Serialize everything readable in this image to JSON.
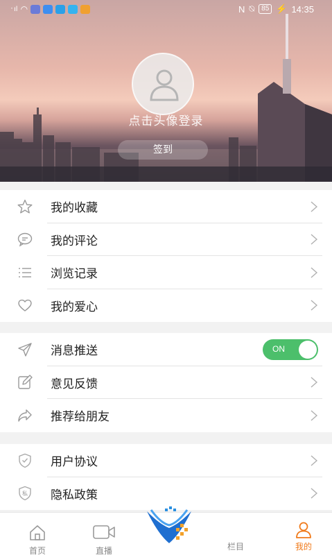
{
  "status_bar": {
    "time": "14:35",
    "battery": "85"
  },
  "profile": {
    "login_prompt": "点击头像登录",
    "checkin_label": "签到"
  },
  "section1": [
    {
      "label": "我的收藏",
      "icon": "star-icon"
    },
    {
      "label": "我的评论",
      "icon": "comment-icon"
    },
    {
      "label": "浏览记录",
      "icon": "list-icon"
    },
    {
      "label": "我的爱心",
      "icon": "heart-icon"
    }
  ],
  "section2": [
    {
      "label": "消息推送",
      "icon": "send-icon",
      "toggle": "ON"
    },
    {
      "label": "意见反馈",
      "icon": "edit-icon"
    },
    {
      "label": "推荐给朋友",
      "icon": "share-icon"
    }
  ],
  "section3": [
    {
      "label": "用户协议",
      "icon": "shield-icon"
    },
    {
      "label": "隐私政策",
      "icon": "privacy-shield-icon",
      "badge": "私"
    }
  ],
  "tabs": [
    {
      "label": "首页",
      "icon": "home-icon"
    },
    {
      "label": "直播",
      "icon": "video-icon"
    },
    {
      "label": "栏目",
      "icon": "column-icon"
    },
    {
      "label": "我的",
      "icon": "user-icon",
      "active": true
    }
  ],
  "colors": {
    "accent": "#f07a1a",
    "toggle_on": "#4cbf6b"
  }
}
